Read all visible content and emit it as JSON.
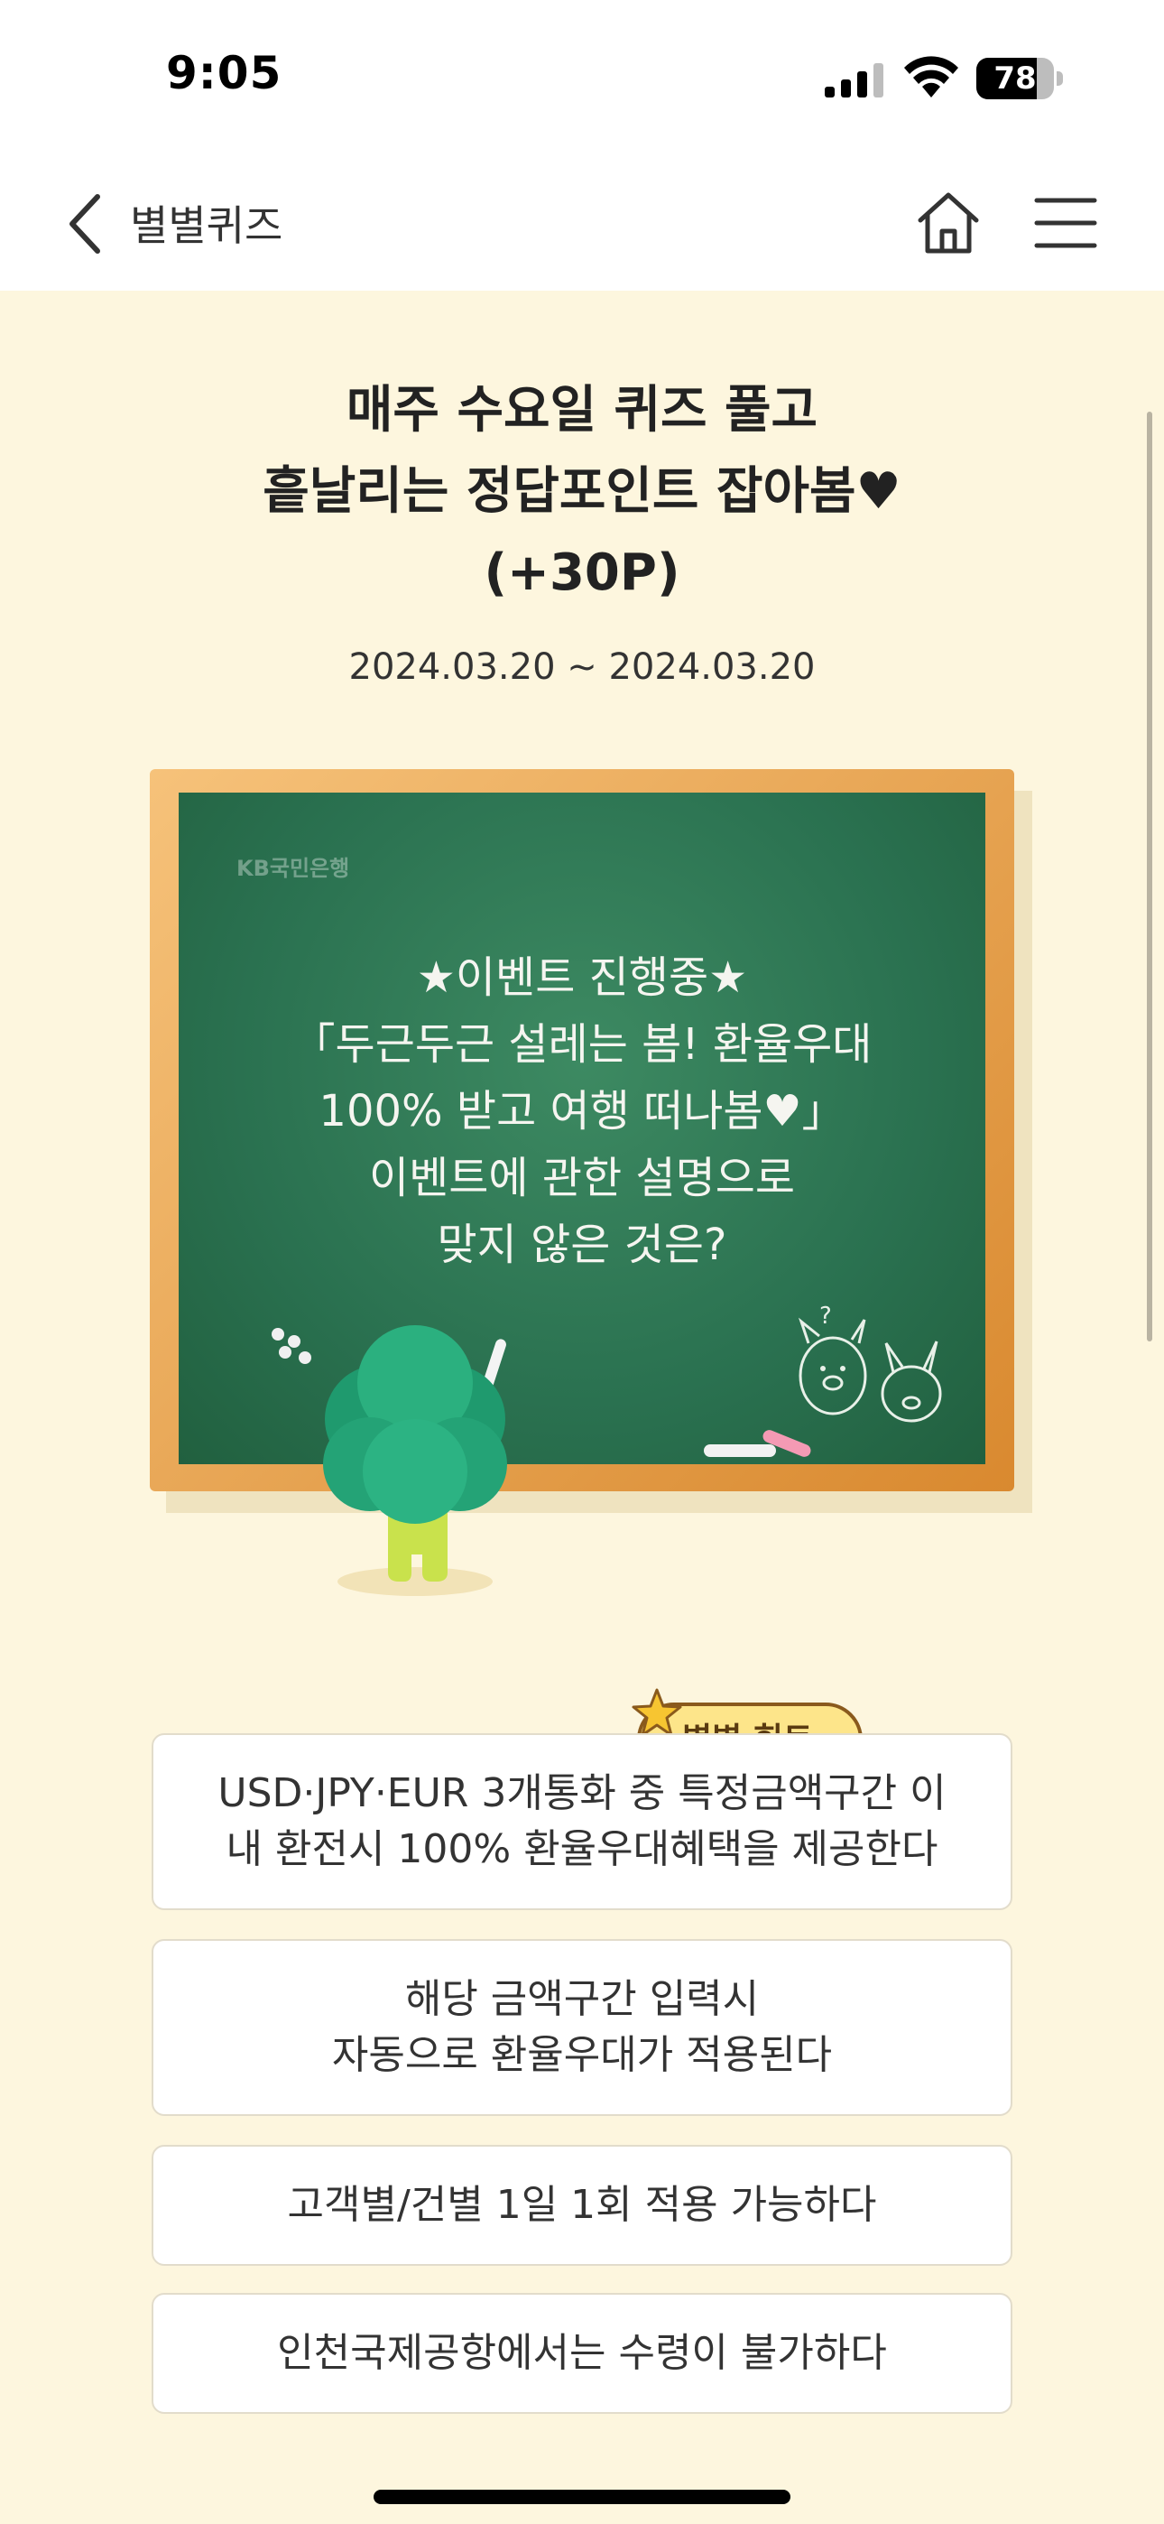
{
  "status": {
    "time": "9:05",
    "battery_level": 78,
    "battery_text": "78"
  },
  "nav": {
    "title": "별별퀴즈",
    "back_icon": "chevron-left-icon",
    "home_icon": "home-icon",
    "menu_icon": "hamburger-menu-icon"
  },
  "event": {
    "title_lines": [
      "매주 수요일 퀴즈 풀고",
      "흩날리는 정답포인트 잡아봄♥",
      "(+30P)"
    ],
    "date": "2024.03.20 ~ 2024.03.20"
  },
  "board": {
    "bank_logo": "KB국민은행",
    "question_lines": [
      "★이벤트 진행중★",
      "「두근두근 설레는 봄! 환율우대",
      "100% 받고 여행 떠나봄♥」",
      "이벤트에 관한 설명으로",
      "맞지 않은 것은?"
    ]
  },
  "hint": {
    "label": "별별 힌트",
    "arrow": "▸"
  },
  "options": [
    {
      "lines": [
        "USD·JPY·EUR 3개통화 중 특정금액구간 이",
        "내 환전시 100% 환율우대혜택을 제공한다"
      ]
    },
    {
      "lines": [
        "해당 금액구간 입력시",
        "자동으로 환율우대가 적용된다"
      ]
    },
    {
      "lines": [
        "고객별/건별 1일 1회 적용 가능하다"
      ]
    },
    {
      "lines": [
        "인천국제공항에서는 수령이 불가하다"
      ]
    }
  ],
  "colors": {
    "page_background": "#fdf6de",
    "board_green": "#2a7150",
    "frame_wood": "#e39a3f",
    "hint_yellow": "#fde58a"
  }
}
